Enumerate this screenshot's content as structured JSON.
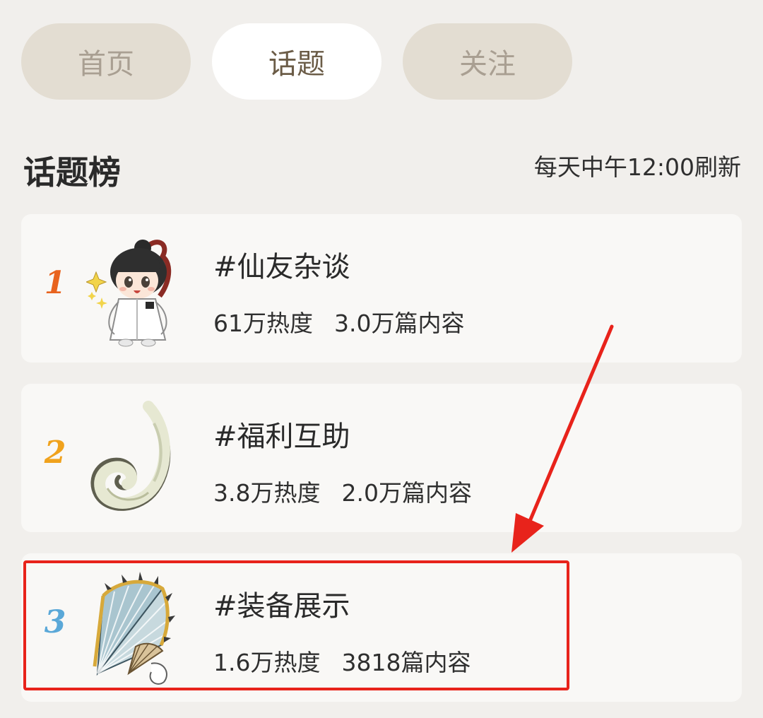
{
  "tabs": [
    {
      "label": "首页",
      "active": false
    },
    {
      "label": "话题",
      "active": true
    },
    {
      "label": "关注",
      "active": false
    }
  ],
  "section": {
    "title": "话题榜",
    "refresh_note": "每天中午12:00刷新"
  },
  "topics": [
    {
      "rank": "1",
      "title": "#仙友杂谈",
      "heat": "61万热度",
      "posts": "3.0万篇内容",
      "rank_color": "#e8631e",
      "icon": "chibi-character-icon"
    },
    {
      "rank": "2",
      "title": "#福利互助",
      "heat": "3.8万热度",
      "posts": "2.0万篇内容",
      "rank_color": "#f0a21c",
      "icon": "jade-hook-icon"
    },
    {
      "rank": "3",
      "title": "#装备展示",
      "heat": "1.6万热度",
      "posts": "3818篇内容",
      "rank_color": "#5aa8d8",
      "icon": "folding-fan-icon"
    }
  ],
  "colors": {
    "background": "#f1efec",
    "card": "#f9f8f6",
    "tab_inactive": "#e3ddd2",
    "tab_active": "#ffffff",
    "annotation": "#e8231b"
  }
}
